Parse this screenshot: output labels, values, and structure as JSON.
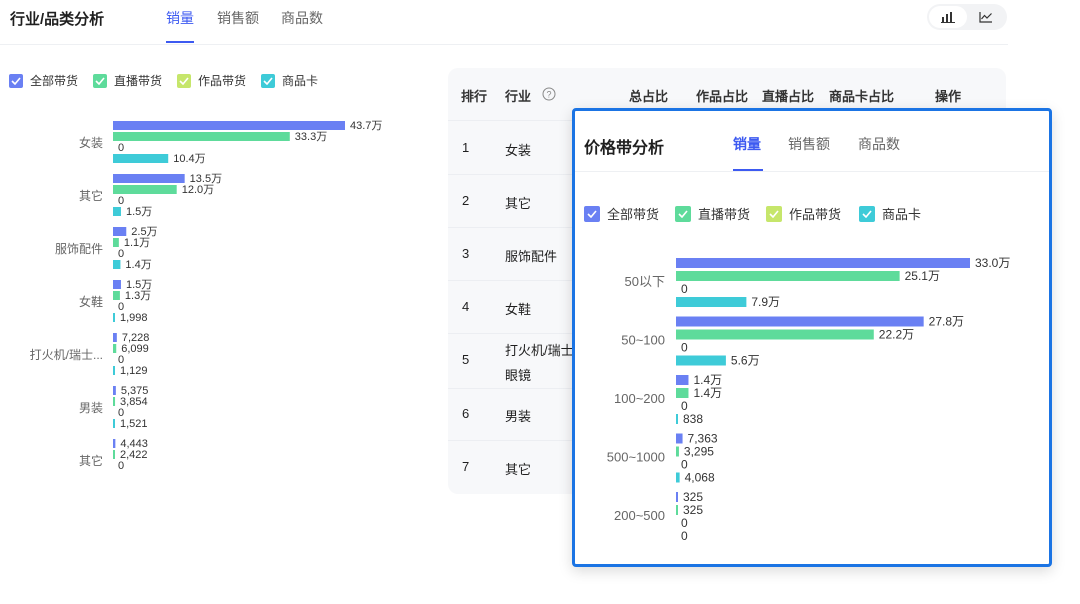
{
  "header": {
    "title": "行业/品类分析",
    "tabs": [
      "销量",
      "销售额",
      "商品数"
    ],
    "active_tab": 0
  },
  "view_toggle": {
    "options": [
      "bar-chart-icon",
      "line-chart-icon"
    ],
    "selected": "bar-chart-icon"
  },
  "colors": {
    "accent": "#3d5af1",
    "series": [
      "#6a80f3",
      "#5edb9b",
      "#c6e66b",
      "#3ecbd8"
    ]
  },
  "legend": [
    "全部带货",
    "直播带货",
    "作品带货",
    "商品卡"
  ],
  "table": {
    "headers": [
      "排行",
      "行业",
      "总占比",
      "作品占比",
      "直播占比",
      "商品卡占比",
      "操作"
    ],
    "help_icon": "question-circle-icon",
    "rows": [
      {
        "rank": "1",
        "industry": "女装"
      },
      {
        "rank": "2",
        "industry": "其它"
      },
      {
        "rank": "3",
        "industry": "服饰配件"
      },
      {
        "rank": "4",
        "industry": "女鞋"
      },
      {
        "rank": "5",
        "industry": "打火机/瑞士",
        "industry_line2": "眼镜"
      },
      {
        "rank": "6",
        "industry": "男装"
      },
      {
        "rank": "7",
        "industry": "其它"
      }
    ]
  },
  "overlay": {
    "title": "价格带分析",
    "tabs": [
      "销量",
      "销售额",
      "商品数"
    ],
    "active_tab": 0
  },
  "chart_data": [
    {
      "type": "bar",
      "orientation": "horizontal",
      "categories": [
        "女装",
        "其它",
        "服饰配件",
        "女鞋",
        "打火机/瑞士...",
        "男装",
        "其它"
      ],
      "series": [
        {
          "name": "全部带货",
          "values": [
            437000,
            135000,
            25000,
            15000,
            7228,
            5375,
            4443
          ],
          "labels": [
            "43.7万",
            "13.5万",
            "2.5万",
            "1.5万",
            "7,228",
            "5,375",
            "4,443"
          ]
        },
        {
          "name": "直播带货",
          "values": [
            333000,
            120000,
            11000,
            13000,
            6099,
            3854,
            2422
          ],
          "labels": [
            "33.3万",
            "12.0万",
            "1.1万",
            "1.3万",
            "6,099",
            "3,854",
            "2,422"
          ]
        },
        {
          "name": "作品带货",
          "values": [
            0,
            0,
            0,
            0,
            0,
            0,
            0
          ],
          "labels": [
            "0",
            "0",
            "0",
            "0",
            "0",
            "0",
            "0"
          ]
        },
        {
          "name": "商品卡",
          "values": [
            104000,
            15000,
            14000,
            1998,
            1129,
            1521,
            null
          ],
          "labels": [
            "10.4万",
            "1.5万",
            "1.4万",
            "1,998",
            "1,129",
            "1,521",
            ""
          ]
        }
      ]
    },
    {
      "type": "bar",
      "orientation": "horizontal",
      "categories": [
        "50以下",
        "50~100",
        "100~200",
        "500~1000",
        "200~500"
      ],
      "series": [
        {
          "name": "全部带货",
          "values": [
            330000,
            278000,
            14000,
            7363,
            325
          ],
          "labels": [
            "33.0万",
            "27.8万",
            "1.4万",
            "7,363",
            "325"
          ]
        },
        {
          "name": "直播带货",
          "values": [
            251000,
            222000,
            14000,
            3295,
            325
          ],
          "labels": [
            "25.1万",
            "22.2万",
            "1.4万",
            "3,295",
            "325"
          ]
        },
        {
          "name": "作品带货",
          "values": [
            0,
            0,
            0,
            0,
            0
          ],
          "labels": [
            "0",
            "0",
            "0",
            "0",
            "0"
          ]
        },
        {
          "name": "商品卡",
          "values": [
            79000,
            56000,
            838,
            4068,
            0
          ],
          "labels": [
            "7.9万",
            "5.6万",
            "838",
            "4,068",
            "0"
          ]
        }
      ]
    }
  ]
}
